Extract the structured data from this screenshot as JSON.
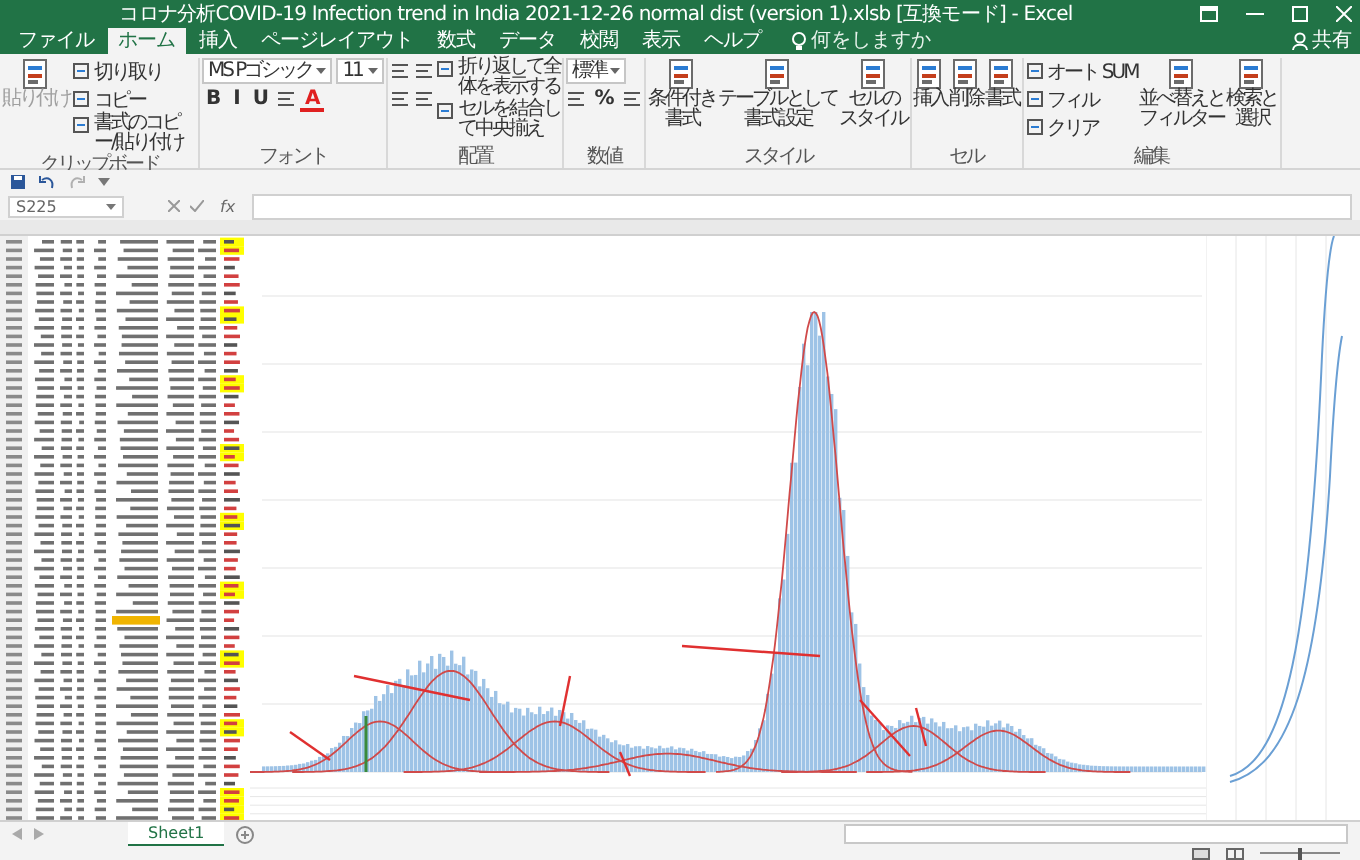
{
  "window": {
    "title": "コロナ分析COVID-19 Infection trend in India 2021-12-26 normal dist (version 1).xlsb [互換モード] - Excel"
  },
  "menu_tabs": [
    {
      "label": "ファイル",
      "selected": false
    },
    {
      "label": "ホーム",
      "selected": true
    },
    {
      "label": "挿入",
      "selected": false
    },
    {
      "label": "ページレイアウト",
      "selected": false
    },
    {
      "label": "数式",
      "selected": false
    },
    {
      "label": "データ",
      "selected": false
    },
    {
      "label": "校閲",
      "selected": false
    },
    {
      "label": "表示",
      "selected": false
    },
    {
      "label": "ヘルプ",
      "selected": false
    }
  ],
  "tell_me": {
    "placeholder": "何をしますか"
  },
  "share": "共有",
  "ribbon": {
    "groups": [
      {
        "label": "クリップボード",
        "columns": [
          [
            [
              {
                "kind": "large",
                "label": "貼り付け",
                "disabled": true
              }
            ]
          ],
          [
            [
              {
                "kind": "small",
                "label": "切り取り"
              }
            ],
            [
              {
                "kind": "small",
                "label": "コピー"
              }
            ],
            [
              {
                "kind": "small_wrap",
                "label": "書式のコピー/貼り付け"
              }
            ]
          ]
        ]
      },
      {
        "label": "フォント",
        "columns": [
          [
            [
              {
                "kind": "dropdown",
                "value": "MS Pゴシック"
              },
              {
                "kind": "dropdown",
                "value": "11"
              }
            ],
            [
              {
                "kind": "glyph",
                "label": "B"
              },
              {
                "kind": "glyph",
                "label": "I"
              },
              {
                "kind": "glyph",
                "label": "U"
              },
              {
                "kind": "icon"
              },
              {
                "kind": "glyph",
                "label": "A",
                "color": "#e02020"
              }
            ]
          ]
        ]
      },
      {
        "label": "配置",
        "columns": [
          [
            [
              {
                "kind": "icon"
              },
              {
                "kind": "icon"
              }
            ],
            [
              {
                "kind": "icon"
              },
              {
                "kind": "icon"
              }
            ]
          ],
          [
            [
              {
                "kind": "small_wrap",
                "label": "折り返して全体を表示する"
              }
            ],
            [
              {
                "kind": "small_wrap",
                "label": "セルを結合して中央揃え"
              }
            ]
          ]
        ]
      },
      {
        "label": "数値",
        "columns": [
          [
            [
              {
                "kind": "dropdown",
                "value": "標準"
              }
            ],
            [
              {
                "kind": "icon"
              },
              {
                "kind": "glyph",
                "label": "%"
              },
              {
                "kind": "icon"
              }
            ]
          ]
        ]
      },
      {
        "label": "スタイル",
        "columns": [
          [
            [
              {
                "kind": "large",
                "lines": [
                  "条件付き",
                  "書式"
                ],
                "disabled": false
              }
            ]
          ],
          [
            [
              {
                "kind": "large",
                "lines": [
                  "テーブルとして",
                  "書式設定"
                ],
                "disabled": false
              }
            ]
          ],
          [
            [
              {
                "kind": "large",
                "lines": [
                  "セルの",
                  "スタイル"
                ],
                "disabled": false
              }
            ]
          ]
        ]
      },
      {
        "label": "セル",
        "columns": [
          [
            [
              {
                "kind": "large",
                "label": "挿入",
                "disabled": false
              }
            ]
          ],
          [
            [
              {
                "kind": "large",
                "label": "削除",
                "disabled": false
              }
            ]
          ],
          [
            [
              {
                "kind": "large",
                "label": "書式",
                "disabled": false
              }
            ]
          ]
        ]
      },
      {
        "label": "編集",
        "columns": [
          [
            [
              {
                "kind": "small",
                "label": "オート SUM"
              }
            ],
            [
              {
                "kind": "small",
                "label": "フィル"
              }
            ],
            [
              {
                "kind": "small",
                "label": "クリア"
              }
            ]
          ],
          [
            [
              {
                "kind": "large",
                "lines": [
                  "並べ替えと",
                  "フィルター"
                ],
                "disabled": false
              }
            ]
          ],
          [
            [
              {
                "kind": "large",
                "lines": [
                  "検索と",
                  "選択"
                ],
                "disabled": false
              }
            ]
          ]
        ]
      }
    ]
  },
  "formula_bar": {
    "name_box": "S225",
    "function_label": "fx"
  },
  "sheets": [
    {
      "label": "Sheet1",
      "selected": true
    }
  ],
  "zoom": {
    "level": 0.5
  }
}
